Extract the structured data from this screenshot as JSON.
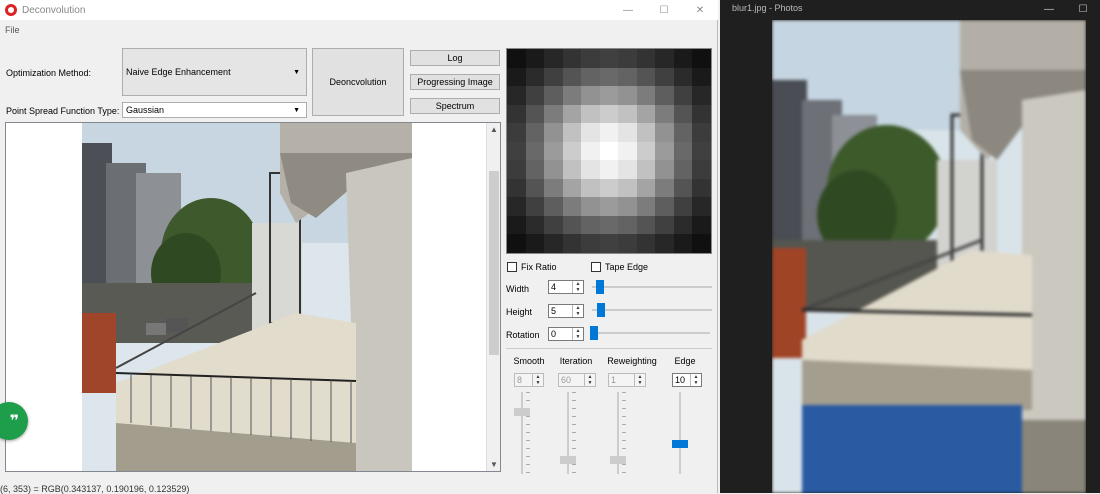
{
  "app": {
    "title": "Deconvolution",
    "menu": [
      "File"
    ],
    "optimization_label": "Optimization Method:",
    "optimization_value": "Naive Edge Enhancement",
    "psf_label": "Point Spread Function Type:",
    "psf_value": "Gaussian",
    "deconvolution_button": "Deoncvolution",
    "log_button": "Log",
    "progressing_button": "Progressing Image",
    "spectrum_button": "Spectrum",
    "fix_ratio": {
      "label": "Fix Ratio",
      "checked": false
    },
    "tape_edge": {
      "label": "Tape Edge",
      "checked": false
    },
    "width": {
      "label": "Width",
      "value": "4"
    },
    "height": {
      "label": "Height",
      "value": "5"
    },
    "rotation": {
      "label": "Rotation",
      "value": "0"
    },
    "params": [
      {
        "label": "Smooth",
        "value": "8",
        "enabled": false
      },
      {
        "label": "Iteration",
        "value": "60",
        "enabled": false
      },
      {
        "label": "Reweighting",
        "value": "1",
        "enabled": false
      },
      {
        "label": "Edge",
        "value": "10",
        "enabled": true
      }
    ],
    "status": "(6, 353) = RGB(0.343137, 0.190196, 0.123529)",
    "chat_icon": "quote-icon"
  },
  "photos": {
    "title": "blur1.jpg - Photos"
  },
  "colors": {
    "accent": "#0078d7",
    "fab": "#1e9e4a",
    "app_icon": "#dd2222"
  }
}
